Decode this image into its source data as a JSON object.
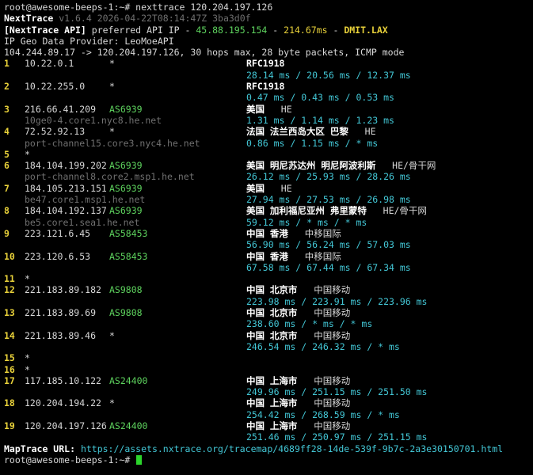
{
  "header": {
    "prompt": "root@awesome-beeps-1:~# nexttrace 120.204.197.126",
    "brand": "NextTrace",
    "version": " v1.6.4 2026-04-22T08:14:47Z 3ba3d0f",
    "api_prefix": "[NextTrace API]",
    "api_mid": " preferred API IP - ",
    "api_ip": "45.88.195.154",
    "api_sep": " - ",
    "api_ms": "214.67ms",
    "api_sep2": " - ",
    "api_pop": "DMIT.LAX",
    "geo_provider": "IP Geo Data Provider: LeoMoeAPI",
    "trace_info": "104.244.89.17 -> 120.204.197.126, 30 hops max, 28 byte packets, ICMP mode"
  },
  "hops": [
    {
      "hop": "1",
      "ip": "10.22.0.1",
      "as": "*",
      "geo": "RFC1918",
      "isp": "",
      "rdns": "",
      "rtt": "28.14 ms / 20.56 ms / 12.37 ms"
    },
    {
      "hop": "2",
      "ip": "10.22.255.0",
      "as": "*",
      "geo": "RFC1918",
      "isp": "",
      "rdns": "",
      "rtt": "0.47 ms / 0.43 ms / 0.53 ms"
    },
    {
      "hop": "3",
      "ip": "216.66.41.209",
      "as": "AS6939",
      "geo": "美国",
      "isp": "HE",
      "rdns": "10ge0-4.core1.nyc8.he.net",
      "rtt": "1.31 ms / 1.14 ms / 1.23 ms"
    },
    {
      "hop": "4",
      "ip": "72.52.92.13",
      "as": "*",
      "geo": "法国 法兰西岛大区 巴黎",
      "isp": "HE",
      "rdns": "port-channel15.core3.nyc4.he.net",
      "rtt": "0.86 ms / 1.15 ms / * ms"
    },
    {
      "hop": "5",
      "ip": "*",
      "as": "",
      "geo": "",
      "isp": "",
      "rdns": "",
      "rtt": ""
    },
    {
      "hop": "6",
      "ip": "184.104.199.202",
      "as": "AS6939",
      "geo": "美国 明尼苏达州 明尼阿波利斯",
      "isp": "HE/骨干网",
      "rdns": "port-channel8.core2.msp1.he.net",
      "rtt": "26.12 ms / 25.93 ms / 28.26 ms"
    },
    {
      "hop": "7",
      "ip": "184.105.213.151",
      "as": "AS6939",
      "geo": "美国",
      "isp": "HE",
      "rdns": "be47.core1.msp1.he.net",
      "rtt": "27.94 ms / 27.53 ms / 26.98 ms"
    },
    {
      "hop": "8",
      "ip": "184.104.192.137",
      "as": "AS6939",
      "geo": "美国 加利福尼亚州 弗里蒙特",
      "isp": "HE/骨干网",
      "rdns": "be5.core1.sea1.he.net",
      "rtt": "59.12 ms / * ms / * ms"
    },
    {
      "hop": "9",
      "ip": "223.121.6.45",
      "as": "AS58453",
      "geo": "中国 香港",
      "isp": "中移国际",
      "rdns": "",
      "rtt": "56.90 ms / 56.24 ms / 57.03 ms"
    },
    {
      "hop": "10",
      "ip": "223.120.6.53",
      "as": "AS58453",
      "geo": "中国 香港",
      "isp": "中移国际",
      "rdns": "",
      "rtt": "67.58 ms / 67.44 ms / 67.34 ms"
    },
    {
      "hop": "11",
      "ip": "*",
      "as": "",
      "geo": "",
      "isp": "",
      "rdns": "",
      "rtt": ""
    },
    {
      "hop": "12",
      "ip": "221.183.89.182",
      "as": "AS9808",
      "geo": "中国 北京市",
      "isp": "中国移动",
      "rdns": "",
      "rtt": "223.98 ms / 223.91 ms / 223.96 ms"
    },
    {
      "hop": "13",
      "ip": "221.183.89.69",
      "as": "AS9808",
      "geo": "中国 北京市",
      "isp": "中国移动",
      "rdns": "",
      "rtt": "238.60 ms / * ms / * ms"
    },
    {
      "hop": "14",
      "ip": "221.183.89.46",
      "as": "*",
      "geo": "中国 北京市",
      "isp": "中国移动",
      "rdns": "",
      "rtt": "246.54 ms / 246.32 ms / * ms"
    },
    {
      "hop": "15",
      "ip": "*",
      "as": "",
      "geo": "",
      "isp": "",
      "rdns": "",
      "rtt": ""
    },
    {
      "hop": "16",
      "ip": "*",
      "as": "",
      "geo": "",
      "isp": "",
      "rdns": "",
      "rtt": ""
    },
    {
      "hop": "17",
      "ip": "117.185.10.122",
      "as": "AS24400",
      "geo": "中国 上海市",
      "isp": "中国移动",
      "rdns": "",
      "rtt": "249.96 ms / 251.15 ms / 251.50 ms"
    },
    {
      "hop": "18",
      "ip": "120.204.194.22",
      "as": "*",
      "geo": "中国 上海市",
      "isp": "中国移动",
      "rdns": "",
      "rtt": "254.42 ms / 268.59 ms / * ms"
    },
    {
      "hop": "19",
      "ip": "120.204.197.126",
      "as": "AS24400",
      "geo": "中国 上海市",
      "isp": "中国移动",
      "rdns": "",
      "rtt": "251.46 ms / 250.97 ms / 251.15 ms"
    }
  ],
  "footer": {
    "map_label": "MapTrace URL: ",
    "map_url": "https://assets.nxtrace.org/tracemap/4689ff28-14de-539f-9b7c-2a3e30150701.html",
    "prompt": "root@awesome-beeps-1:~# "
  },
  "colors": {
    "background": "#000000",
    "hop_number": "#e8d13a",
    "as_number": "#5ed35e",
    "rtt": "#43c7d6",
    "rdns": "#707070"
  }
}
